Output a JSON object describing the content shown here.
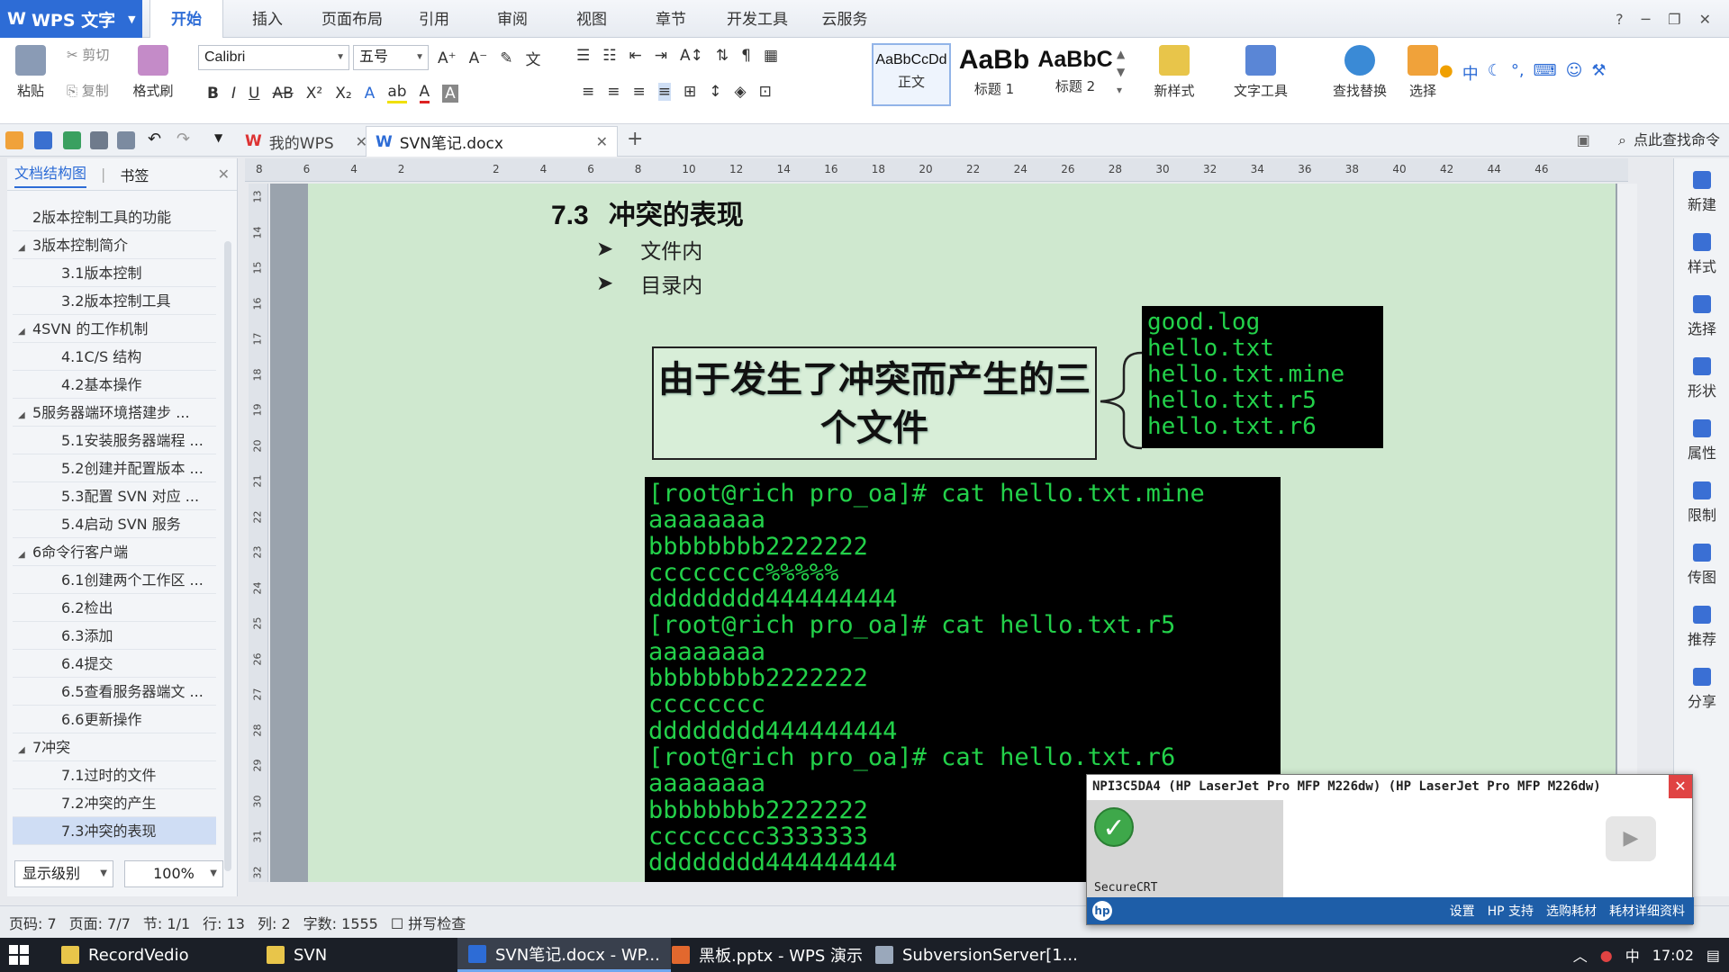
{
  "app": {
    "name": "WPS 文字",
    "menu_tabs": [
      "开始",
      "插入",
      "页面布局",
      "引用",
      "审阅",
      "视图",
      "章节",
      "开发工具",
      "云服务"
    ],
    "window_ctrls": [
      "?",
      "─",
      "❐",
      "✕"
    ]
  },
  "ribbon": {
    "paste": "粘贴",
    "cut": "剪切",
    "copy": "复制",
    "format_painter": "格式刷",
    "font_name": "Calibri",
    "font_size": "五号",
    "styles": [
      {
        "sample": "AaBbCcDd",
        "label": "正文"
      },
      {
        "sample": "AaBb",
        "label": "标题 1"
      },
      {
        "sample": "AaBbC",
        "label": "标题 2"
      }
    ],
    "new_style": "新样式",
    "text_tools": "文字工具",
    "find_replace": "查找替换",
    "select": "选择"
  },
  "tabs": {
    "my_wps": "我的WPS",
    "doc": "SVN笔记.docx",
    "find_cmd": "点此查找命令"
  },
  "nav": {
    "tab_outline": "文档结构图",
    "tab_bookmark": "书签",
    "items": [
      {
        "label": "2版本控制工具的功能",
        "level": 1,
        "toggle": ""
      },
      {
        "label": "3版本控制简介",
        "level": 1,
        "toggle": "◢"
      },
      {
        "label": "3.1版本控制",
        "level": 2,
        "toggle": ""
      },
      {
        "label": "3.2版本控制工具",
        "level": 2,
        "toggle": ""
      },
      {
        "label": "4SVN 的工作机制",
        "level": 1,
        "toggle": "◢"
      },
      {
        "label": "4.1C/S 结构",
        "level": 2,
        "toggle": ""
      },
      {
        "label": "4.2基本操作",
        "level": 2,
        "toggle": ""
      },
      {
        "label": "5服务器端环境搭建步 ...",
        "level": 1,
        "toggle": "◢"
      },
      {
        "label": "5.1安装服务器端程 ...",
        "level": 2,
        "toggle": ""
      },
      {
        "label": "5.2创建并配置版本 ...",
        "level": 2,
        "toggle": ""
      },
      {
        "label": "5.3配置 SVN 对应 ...",
        "level": 2,
        "toggle": ""
      },
      {
        "label": "5.4启动 SVN 服务",
        "level": 2,
        "toggle": ""
      },
      {
        "label": "6命令行客户端",
        "level": 1,
        "toggle": "◢"
      },
      {
        "label": "6.1创建两个工作区 ...",
        "level": 2,
        "toggle": ""
      },
      {
        "label": "6.2检出",
        "level": 2,
        "toggle": ""
      },
      {
        "label": "6.3添加",
        "level": 2,
        "toggle": ""
      },
      {
        "label": "6.4提交",
        "level": 2,
        "toggle": ""
      },
      {
        "label": "6.5查看服务器端文 ...",
        "level": 2,
        "toggle": ""
      },
      {
        "label": "6.6更新操作",
        "level": 2,
        "toggle": ""
      },
      {
        "label": "7冲突",
        "level": 1,
        "toggle": "◢"
      },
      {
        "label": "7.1过时的文件",
        "level": 2,
        "toggle": ""
      },
      {
        "label": "7.2冲突的产生",
        "level": 2,
        "toggle": ""
      },
      {
        "label": "7.3冲突的表现",
        "level": 2,
        "toggle": "",
        "selected": true
      }
    ],
    "level_select": "显示级别",
    "zoom": "100%"
  },
  "ruler": {
    "h_ticks": [
      "8",
      "6",
      "4",
      "2",
      "",
      "2",
      "4",
      "6",
      "8",
      "10",
      "12",
      "14",
      "16",
      "18",
      "20",
      "22",
      "24",
      "26",
      "28",
      "30",
      "32",
      "34",
      "36",
      "38",
      "40",
      "42",
      "44",
      "46"
    ],
    "v_ticks": [
      "13",
      "14",
      "15",
      "16",
      "17",
      "18",
      "19",
      "20",
      "21",
      "22",
      "23",
      "24",
      "25",
      "26",
      "27",
      "28",
      "29",
      "30",
      "31",
      "32"
    ]
  },
  "doc": {
    "heading_num": "7.3",
    "heading_text": "冲突的表现",
    "bullets": [
      "文件内",
      "目录内"
    ],
    "callout": "由于发生了冲突而产生的三个文件",
    "files": [
      "good.log",
      "hello.txt",
      "hello.txt.mine",
      "hello.txt.r5",
      "hello.txt.r6"
    ],
    "terminal": [
      "[root@rich pro_oa]# cat hello.txt.mine",
      "aaaaaaaa",
      "bbbbbbbb2222222",
      "cccccccc%%%%%",
      "dddddddd444444444",
      "[root@rich pro_oa]# cat hello.txt.r5",
      "aaaaaaaa",
      "bbbbbbbb2222222",
      "cccccccc",
      "dddddddd444444444",
      "[root@rich pro_oa]# cat hello.txt.r6",
      "aaaaaaaa",
      "bbbbbbbb2222222",
      "cccccccc3333333",
      "dddddddd444444444"
    ]
  },
  "right_sidebar": [
    "新建",
    "样式",
    "选择",
    "形状",
    "属性",
    "限制",
    "传图",
    "推荐",
    "分享"
  ],
  "status": {
    "page_code": "页码: 7",
    "pages": "页面: 7/7",
    "section": "节: 1/1",
    "row": "行: 13",
    "col": "列: 2",
    "words": "字数: 1555",
    "spell": "拼写检查"
  },
  "popup": {
    "title": "NPI3C5DA4 (HP LaserJet Pro MFP M226dw) (HP LaserJet Pro MFP M226dw)",
    "app_label": "SecureCRT",
    "links": [
      "设置",
      "HP 支持",
      "选购耗材",
      "耗材详细资料"
    ]
  },
  "taskbar": {
    "items": [
      "RecordVedio",
      "SVN",
      "SVN笔记.docx - WP...",
      "黑板.pptx - WPS 演示",
      "SubversionServer[1..."
    ],
    "ime": "中",
    "time": "17:02"
  },
  "colors": {
    "accent": "#2d6cd6",
    "page_bg": "#cfe8cf",
    "terminal_fg": "#23d14a"
  }
}
